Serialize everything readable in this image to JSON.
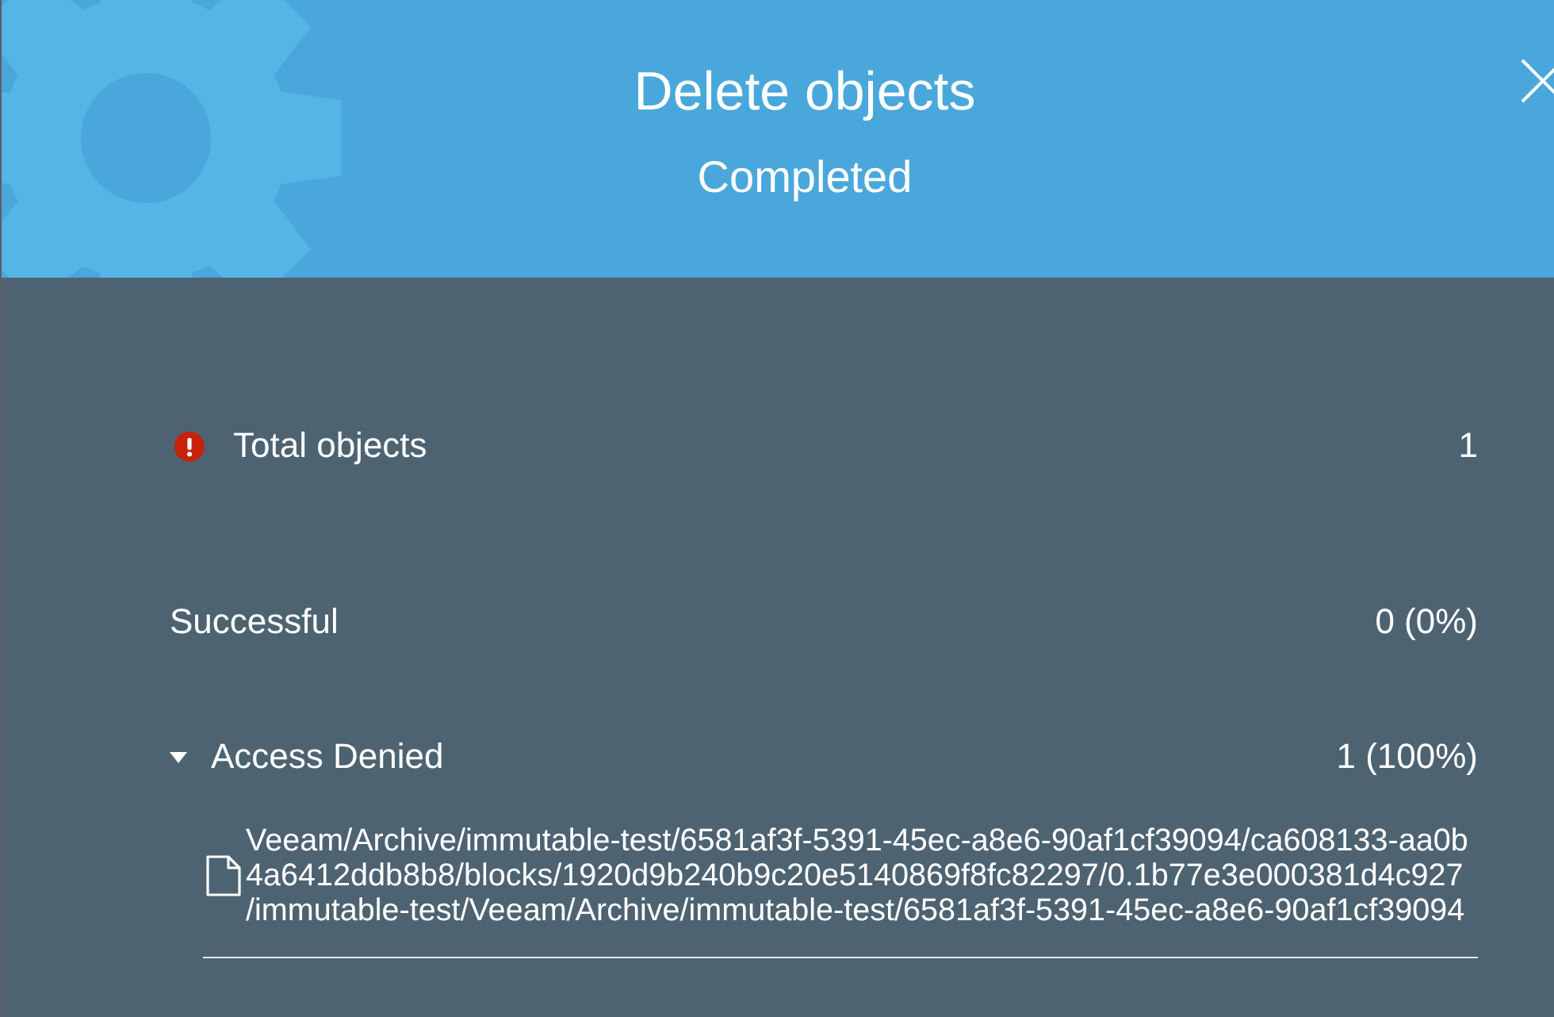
{
  "dialog": {
    "title": "Delete objects",
    "status": "Completed"
  },
  "total": {
    "label": "Total objects",
    "value": "1",
    "error": true
  },
  "results": [
    {
      "kind": "plain",
      "label": "Successful",
      "value": "0 (0%)"
    },
    {
      "kind": "expandable",
      "label": "Access Denied",
      "value": "1 (100%)",
      "expanded": true,
      "objects": [
        {
          "path_lines": [
            "Veeam/Archive/immutable-test/6581af3f-5391-45ec-a8e6-90af1cf39094/ca608133-aa0b",
            "4a6412ddb8b8/blocks/1920d9b240b9c20e5140869f8fc82297/0.1b77e3e000381d4c927",
            "/immutable-test/Veeam/Archive/immutable-test/6581af3f-5391-45ec-a8e6-90af1cf39094"
          ]
        }
      ]
    }
  ]
}
